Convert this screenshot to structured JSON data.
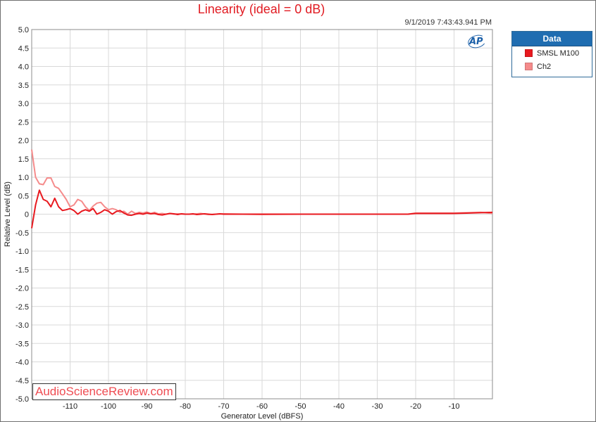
{
  "window": {
    "timestamp": "9/1/2019 7:43:43.941 PM",
    "logo_text": "AP"
  },
  "legend": {
    "title": "Data",
    "items": [
      {
        "label": "SMSL M100",
        "color": "#e8191f"
      },
      {
        "label": "Ch2",
        "color": "#f58b8b"
      }
    ]
  },
  "watermark": "AudioScienceReview.com",
  "chart_data": {
    "type": "line",
    "title": "Linearity (ideal = 0 dB)",
    "xlabel": "Generator Level (dBFS)",
    "ylabel": "Relative Level (dB)",
    "xlim": [
      -120,
      0
    ],
    "ylim": [
      -5.0,
      5.0
    ],
    "x_ticks": [
      -110,
      -100,
      -90,
      -80,
      -70,
      -60,
      -50,
      -40,
      -30,
      -20,
      -10
    ],
    "y_ticks": [
      5.0,
      4.5,
      4.0,
      3.5,
      3.0,
      2.5,
      2.0,
      1.5,
      1.0,
      0.5,
      0,
      -0.5,
      -1.0,
      -1.5,
      -2.0,
      -2.5,
      -3.0,
      -3.5,
      -4.0,
      -4.5,
      -5.0
    ],
    "y_tick_labels": [
      "5.0",
      "4.5",
      "4.0",
      "3.5",
      "3.0",
      "2.5",
      "2.0",
      "1.5",
      "1.0",
      "0.5",
      "0",
      "-0.5",
      "-1.0",
      "-1.5",
      "-2.0",
      "-2.5",
      "-3.0",
      "-3.5",
      "-4.0",
      "-4.5",
      "-5.0"
    ],
    "grid": true,
    "legend_position": "right",
    "series": [
      {
        "name": "SMSL M100",
        "color": "#e8191f",
        "points": [
          [
            -120,
            -0.38
          ],
          [
            -119,
            0.25
          ],
          [
            -118,
            0.65
          ],
          [
            -117,
            0.4
          ],
          [
            -116,
            0.35
          ],
          [
            -115,
            0.2
          ],
          [
            -114,
            0.43
          ],
          [
            -113,
            0.2
          ],
          [
            -112,
            0.1
          ],
          [
            -111,
            0.12
          ],
          [
            -110,
            0.15
          ],
          [
            -109,
            0.1
          ],
          [
            -108,
            0.0
          ],
          [
            -107,
            0.08
          ],
          [
            -106,
            0.12
          ],
          [
            -105,
            0.08
          ],
          [
            -104,
            0.15
          ],
          [
            -103,
            0.0
          ],
          [
            -102,
            0.05
          ],
          [
            -101,
            0.12
          ],
          [
            -100,
            0.08
          ],
          [
            -99,
            0.0
          ],
          [
            -98,
            0.07
          ],
          [
            -97,
            0.1
          ],
          [
            -96,
            0.03
          ],
          [
            -95,
            -0.02
          ],
          [
            -94,
            -0.03
          ],
          [
            -93,
            0.0
          ],
          [
            -92,
            0.02
          ],
          [
            -91,
            0.0
          ],
          [
            -90,
            0.03
          ],
          [
            -89,
            0.01
          ],
          [
            -88,
            0.02
          ],
          [
            -87,
            -0.01
          ],
          [
            -86,
            -0.02
          ],
          [
            -85,
            0.0
          ],
          [
            -84,
            0.02
          ],
          [
            -83,
            0.01
          ],
          [
            -82,
            -0.01
          ],
          [
            -81,
            0.01
          ],
          [
            -80,
            0.0
          ],
          [
            -79,
            0.0
          ],
          [
            -78,
            0.01
          ],
          [
            -77,
            -0.01
          ],
          [
            -76,
            0.0
          ],
          [
            -75,
            0.01
          ],
          [
            -74,
            0.0
          ],
          [
            -73,
            -0.01
          ],
          [
            -72,
            0.0
          ],
          [
            -71,
            0.01
          ],
          [
            -70,
            0.0
          ],
          [
            -65,
            0.0
          ],
          [
            -60,
            0.0
          ],
          [
            -50,
            0.0
          ],
          [
            -40,
            0.0
          ],
          [
            -30,
            0.0
          ],
          [
            -22,
            0.0
          ],
          [
            -20,
            0.02
          ],
          [
            -15,
            0.02
          ],
          [
            -10,
            0.02
          ],
          [
            -6,
            0.03
          ],
          [
            -3,
            0.04
          ],
          [
            0,
            0.05
          ]
        ]
      },
      {
        "name": "Ch2",
        "color": "#f58b8b",
        "points": [
          [
            -120,
            1.75
          ],
          [
            -119,
            1.0
          ],
          [
            -118,
            0.82
          ],
          [
            -117,
            0.8
          ],
          [
            -116,
            0.98
          ],
          [
            -115,
            0.98
          ],
          [
            -114,
            0.75
          ],
          [
            -113,
            0.7
          ],
          [
            -112,
            0.55
          ],
          [
            -111,
            0.4
          ],
          [
            -110,
            0.2
          ],
          [
            -109,
            0.25
          ],
          [
            -108,
            0.4
          ],
          [
            -107,
            0.35
          ],
          [
            -106,
            0.2
          ],
          [
            -105,
            0.1
          ],
          [
            -104,
            0.22
          ],
          [
            -103,
            0.3
          ],
          [
            -102,
            0.32
          ],
          [
            -101,
            0.2
          ],
          [
            -100,
            0.12
          ],
          [
            -99,
            0.15
          ],
          [
            -98,
            0.12
          ],
          [
            -97,
            0.05
          ],
          [
            -96,
            0.08
          ],
          [
            -95,
            0.0
          ],
          [
            -94,
            0.08
          ],
          [
            -93,
            0.02
          ],
          [
            -92,
            0.05
          ],
          [
            -91,
            0.03
          ],
          [
            -90,
            0.06
          ],
          [
            -89,
            0.02
          ],
          [
            -88,
            0.05
          ],
          [
            -87,
            0.01
          ],
          [
            -86,
            0.02
          ],
          [
            -85,
            0.0
          ],
          [
            -84,
            0.02
          ],
          [
            -83,
            0.0
          ],
          [
            -82,
            0.01
          ],
          [
            -80,
            0.0
          ],
          [
            -78,
            0.0
          ],
          [
            -76,
            0.02
          ],
          [
            -74,
            -0.01
          ],
          [
            -72,
            0.0
          ],
          [
            -70,
            0.01
          ],
          [
            -65,
            0.0
          ],
          [
            -60,
            -0.01
          ],
          [
            -50,
            0.0
          ],
          [
            -40,
            0.0
          ],
          [
            -30,
            0.0
          ],
          [
            -22,
            0.0
          ],
          [
            -20,
            0.03
          ],
          [
            -15,
            0.03
          ],
          [
            -10,
            0.03
          ],
          [
            -6,
            0.04
          ],
          [
            -3,
            0.05
          ],
          [
            0,
            0.02
          ]
        ]
      }
    ]
  }
}
